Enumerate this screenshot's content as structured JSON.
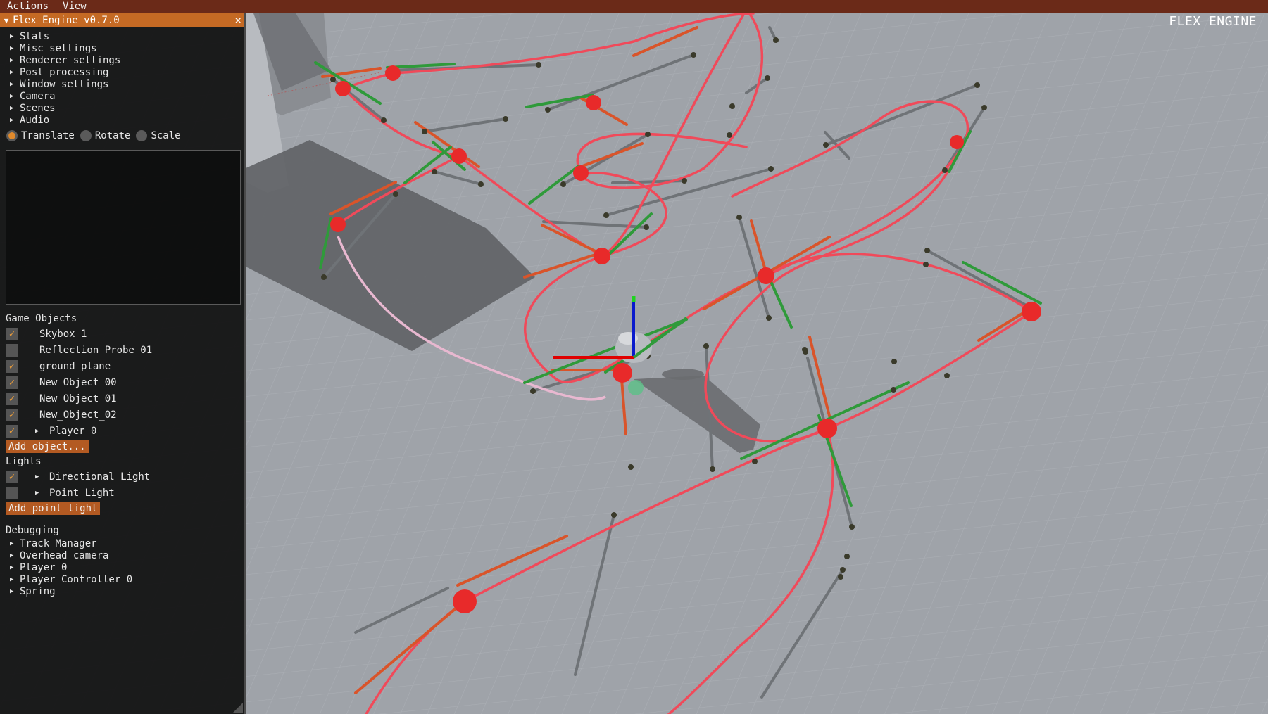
{
  "menubar": {
    "items": [
      "Actions",
      "View"
    ]
  },
  "viewport": {
    "engine_label": "FLEX ENGINE"
  },
  "panel": {
    "title": "Flex Engine v0.7.0",
    "sections": [
      "Stats",
      "Misc settings",
      "Renderer settings",
      "Post processing",
      "Window settings",
      "Camera",
      "Scenes",
      "Audio"
    ],
    "transform_modes": [
      {
        "label": "Translate",
        "selected": true
      },
      {
        "label": "Rotate",
        "selected": false
      },
      {
        "label": "Scale",
        "selected": false
      }
    ],
    "game_objects_title": "Game Objects",
    "game_objects": [
      {
        "name": "Skybox 1",
        "checked": true,
        "expandable": false
      },
      {
        "name": "Reflection Probe 01",
        "checked": false,
        "expandable": false
      },
      {
        "name": "ground plane",
        "checked": true,
        "expandable": false
      },
      {
        "name": "New_Object_00",
        "checked": true,
        "expandable": false
      },
      {
        "name": "New_Object_01",
        "checked": true,
        "expandable": false
      },
      {
        "name": "New_Object_02",
        "checked": true,
        "expandable": false
      },
      {
        "name": "Player 0",
        "checked": true,
        "expandable": true
      }
    ],
    "add_object_label": "Add object...",
    "lights_title": "Lights",
    "lights": [
      {
        "name": "Directional Light",
        "checked": true,
        "expandable": true
      },
      {
        "name": "Point Light",
        "checked": false,
        "expandable": true
      }
    ],
    "add_point_light_label": "Add point light",
    "debugging_title": "Debugging",
    "debugging": [
      "Track Manager",
      "Overhead camera",
      "Player 0",
      "Player Controller 0",
      "Spring"
    ]
  },
  "colors": {
    "menubar": "#6b2a18",
    "panel_title": "#c56a24",
    "accent": "#e08a2c",
    "button": "#b35a22",
    "track": "#f04a5a",
    "node": "#e82a2a",
    "handle_green": "#2f9a3a",
    "handle_orange": "#d9542a",
    "active_track": "#e8b8d0"
  }
}
